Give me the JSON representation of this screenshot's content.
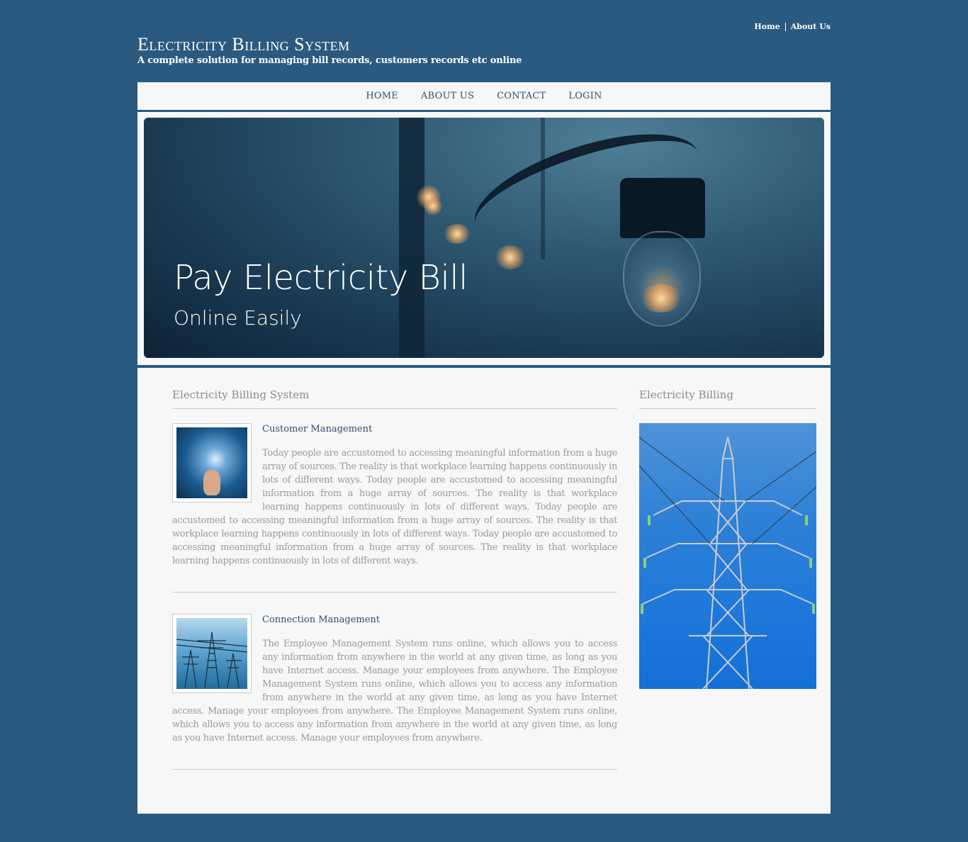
{
  "top_links": [
    "Home",
    "About Us"
  ],
  "site": {
    "title": "Electricity Billing System",
    "subtitle": "A complete solution for managing bill records, customers records etc online"
  },
  "nav": [
    "HOME",
    "ABOUT US",
    "CONTACT",
    "LOGIN"
  ],
  "banner": {
    "heading": "Pay Electricity Bill",
    "subheading": "Online Easily"
  },
  "main": {
    "title": "Electricity Billing System",
    "articles": [
      {
        "title": "Customer Management",
        "body": "Today people are accustomed to accessing meaningful information from a huge array of sources. The reality is that workplace learning happens continuously in lots of different ways. Today people are accustomed to accessing meaningful information from a huge array of sources. The reality is that workplace learning happens continuously in lots of different ways. Today people are accustomed to accessing meaningful information from a huge array of sources. The reality is that workplace learning happens continuously in lots of different ways. Today people are accustomed to accessing meaningful information from a huge array of sources. The reality is that workplace learning happens continuously in lots of different ways.",
        "image_icon": "lightbulb-in-hand-image"
      },
      {
        "title": "Connection Management",
        "body": "The Employee Management System runs online, which allows you to access any information from anywhere in the world at any given time, as long as you have Internet access. Manage your employees from anywhere. The Employee Management System runs online, which allows you to access any information from anywhere in the world at any given time, as long as you have Internet access. Manage your employees from anywhere. The Employee Management System runs online, which allows you to access any information from anywhere in the world at any given time, as long as you have Internet access. Manage your employees from anywhere.",
        "image_icon": "power-pylons-image"
      }
    ]
  },
  "sidebar": {
    "title": "Electricity Billing",
    "image_icon": "transmission-tower-image"
  },
  "colors": {
    "page_bg": "#2a5a80",
    "panel_bg": "#f7f7f7",
    "link": "#2a4f6e",
    "body_text": "#9a9a9a"
  }
}
